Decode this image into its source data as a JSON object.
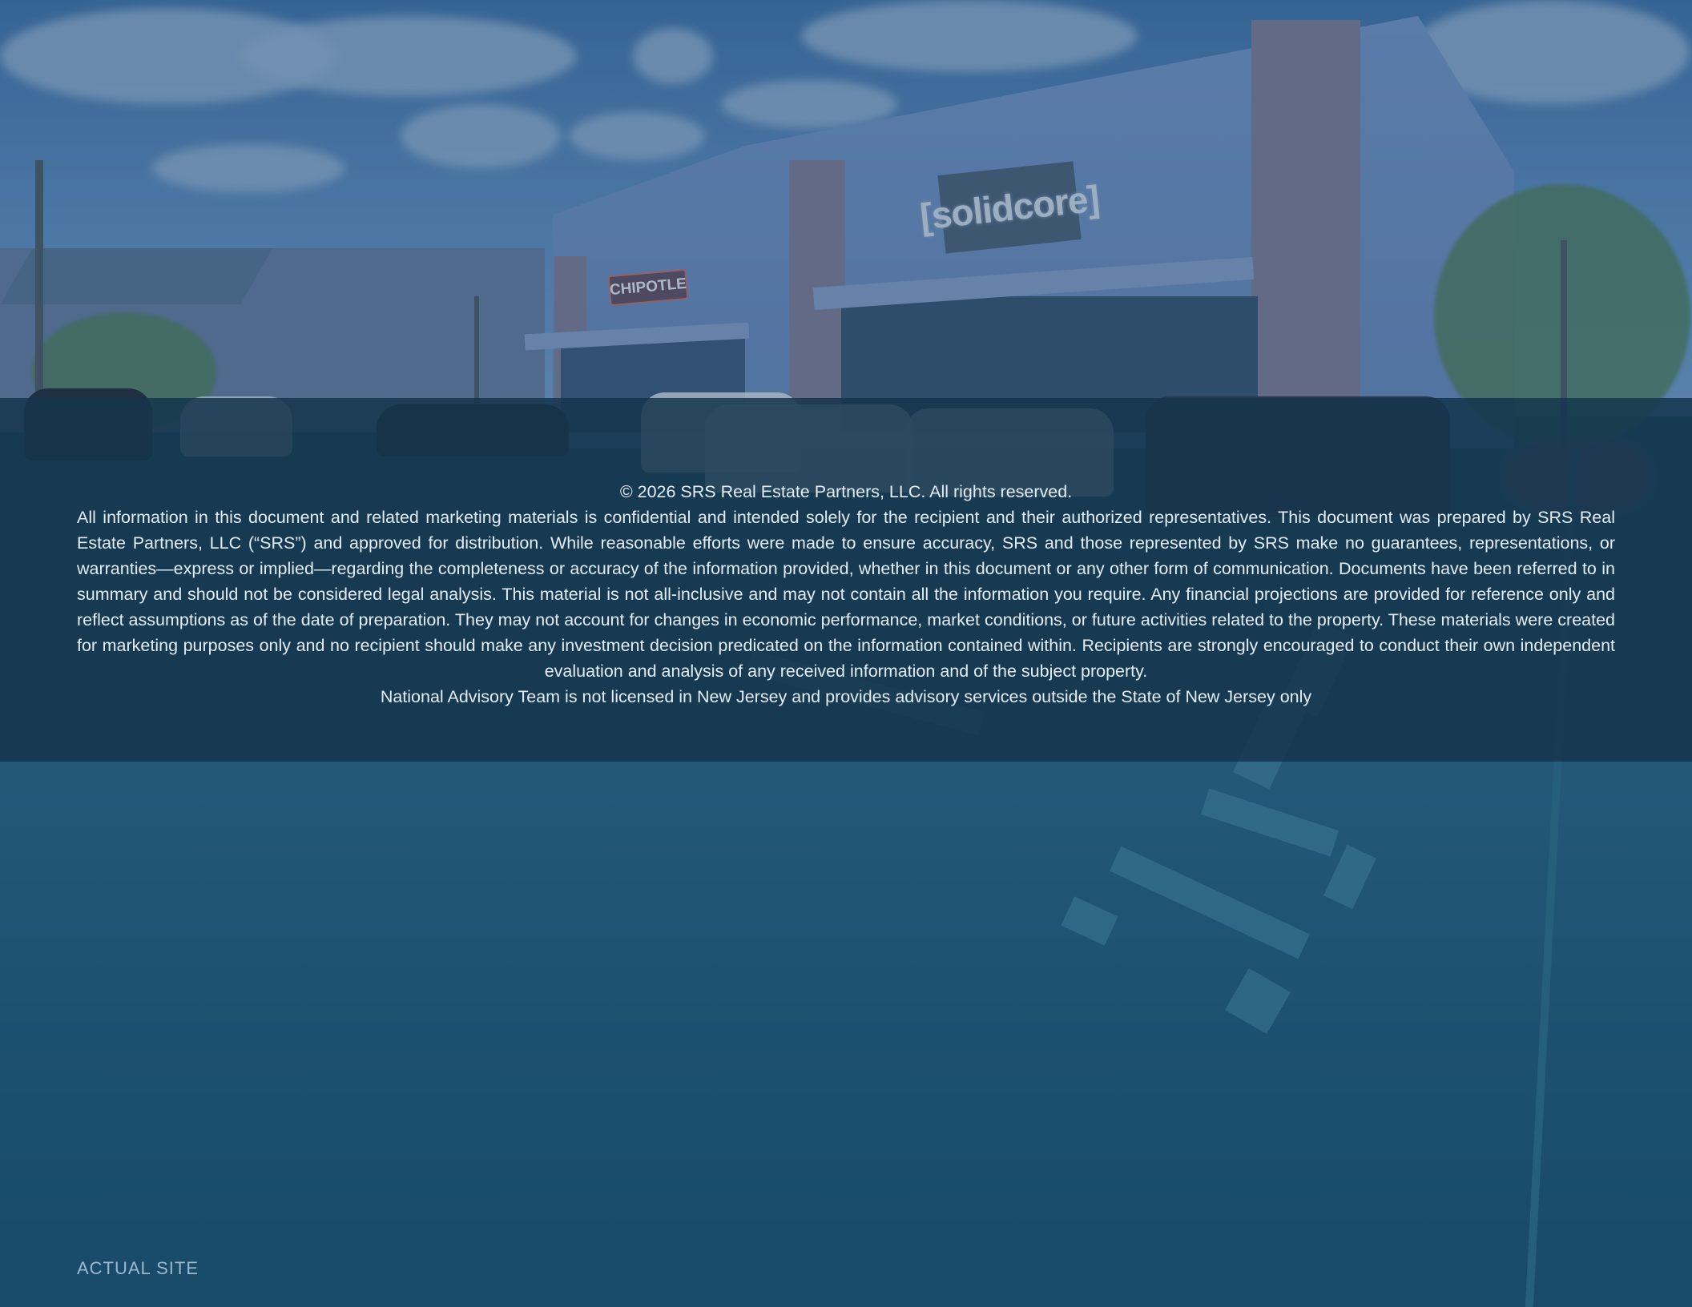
{
  "background": {
    "description_icon": "site-photo",
    "signs": {
      "solidcore": "[solidcore]",
      "chipotle": "CHIPOTLE"
    }
  },
  "legal": {
    "copyright": "© 2026 SRS Real Estate Partners, LLC. All rights reserved.",
    "disclaimer": "All information in this document and related marketing materials is confidential and intended solely for the recipient and their authorized representatives. This document was prepared by SRS Real Estate Partners, LLC (“SRS”) and approved for distribution. While reasonable efforts were made to ensure accuracy, SRS and those represented by SRS make no guarantees, representations, or warranties—express or implied—regarding the completeness or accuracy of the information provided, whether in this document or any other form of communication. Documents have been referred to in summary and should not be considered legal analysis. This material is not all-inclusive and may not contain all the information you require. Any financial projections are provided for reference only and reflect assumptions as of the date of preparation. They may not account for changes in economic performance, market conditions, or future activities related to the property. These materials were created for marketing purposes only and no recipient should make any investment decision predicated on the information contained within. Recipients are strongly encouraged to conduct their own independent evaluation and analysis of any received information and of the subject property.",
    "license_note": "National Advisory Team is not licensed in New Jersey and provides advisory services outside the State of New Jersey only"
  },
  "caption": "ACTUAL SITE",
  "colors": {
    "overlay_band": "#15354d",
    "text": "#e4ecf3",
    "caption": "#9db8c9"
  }
}
